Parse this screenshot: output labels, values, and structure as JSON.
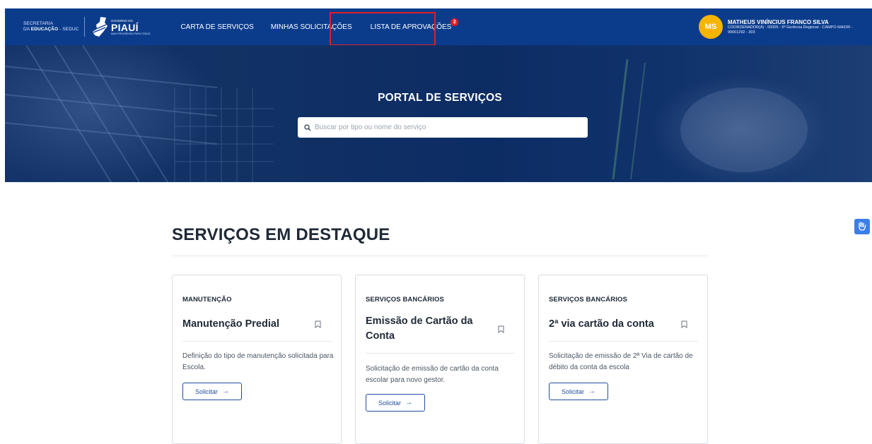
{
  "header": {
    "seduc_line1": "SECRETARIA",
    "seduc_line2_prefix": "DA ",
    "seduc_line2_bold": "EDUCAÇÃO",
    "seduc_line2_suffix": " - SEDUC",
    "gov_label": "GOVERNO DO",
    "state_name": "PIAUÍ",
    "slogan": "MAIS PROGRESSO PARA TODOS",
    "nav": [
      {
        "label": "CARTA DE SERVIÇOS"
      },
      {
        "label": "MINHAS SOLICITAÇÕES"
      },
      {
        "label": "LISTA DE APROVAÇÕES",
        "badge": "2"
      }
    ],
    "user": {
      "initials": "MS",
      "name": "MATHEUS VINÍNCIUS FRANCO SILVA",
      "role": "COORDENADOR(A) - 00005 - 5ª Gerência Regional - CAMPO MAIOR - 99001292 - 303"
    }
  },
  "hero": {
    "title": "PORTAL DE SERVIÇOS",
    "search_placeholder": "Buscar por tipo ou nome do serviço",
    "search_value": ""
  },
  "featured": {
    "title": "SERVIÇOS EM DESTAQUE",
    "cards": [
      {
        "category": "MANUTENÇÃO",
        "title": "Manutenção Predial",
        "description": "Definição do tipo de manutenção solicitada para Escola.",
        "button": "Solicitar"
      },
      {
        "category": "SERVIÇOS BANCÁRIOS",
        "title": "Emissão de Cartão da Conta",
        "description": "Solicitação de emissão de cartão da conta escolar para novo gestor.",
        "button": "Solicitar"
      },
      {
        "category": "SERVIÇOS BANCÁRIOS",
        "title": "2ª via cartão da conta",
        "description": "Solicitação de emissão de 2ª Via de cartão de débito da conta da escola",
        "button": "Solicitar"
      }
    ]
  },
  "colors": {
    "nav_bg": "#0b3c8c",
    "accent_red": "#e01e26",
    "avatar_bg": "#f5b400",
    "button_blue": "#1f4e9c"
  }
}
